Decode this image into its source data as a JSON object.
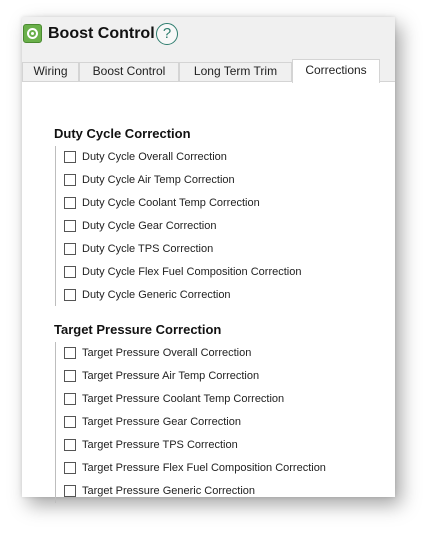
{
  "app": {
    "title": "Boost Control",
    "help_glyph": "?"
  },
  "tabs": [
    {
      "label": "Wiring",
      "active": false
    },
    {
      "label": "Boost Control",
      "active": false
    },
    {
      "label": "Long Term Trim",
      "active": false
    },
    {
      "label": "Corrections",
      "active": true
    }
  ],
  "duty_cycle": {
    "title": "Duty Cycle Correction",
    "items": [
      {
        "label": "Duty Cycle Overall Correction",
        "checked": false
      },
      {
        "label": "Duty Cycle Air Temp Correction",
        "checked": false
      },
      {
        "label": "Duty Cycle Coolant Temp Correction",
        "checked": false
      },
      {
        "label": "Duty Cycle Gear Correction",
        "checked": false
      },
      {
        "label": "Duty Cycle TPS Correction",
        "checked": false
      },
      {
        "label": "Duty Cycle Flex Fuel Composition Correction",
        "checked": false
      },
      {
        "label": "Duty Cycle Generic Correction",
        "checked": false
      }
    ]
  },
  "target_pressure": {
    "title": "Target Pressure Correction",
    "items": [
      {
        "label": "Target Pressure Overall Correction",
        "checked": false
      },
      {
        "label": "Target Pressure Air Temp Correction",
        "checked": false
      },
      {
        "label": "Target Pressure Coolant Temp Correction",
        "checked": false
      },
      {
        "label": "Target Pressure Gear Correction",
        "checked": false
      },
      {
        "label": "Target Pressure TPS Correction",
        "checked": false
      },
      {
        "label": "Target Pressure Flex Fuel Composition Correction",
        "checked": false
      },
      {
        "label": "Target Pressure Generic Correction",
        "checked": false
      }
    ]
  },
  "colors": {
    "accent": "#2e7d6e",
    "icon_green": "#6ab04a"
  }
}
